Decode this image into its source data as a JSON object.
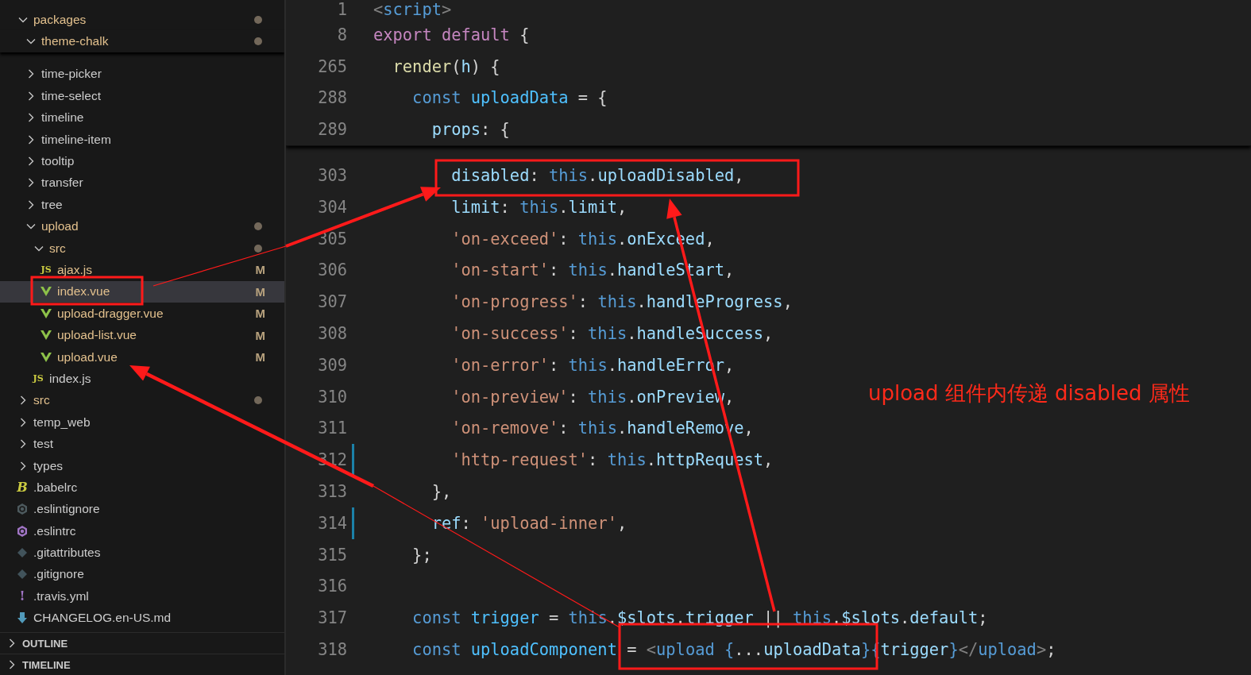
{
  "explorer": {
    "items": [
      {
        "name": "packages",
        "kind": "folder",
        "expanded": true,
        "dot": true,
        "selected": false,
        "children": [
          {
            "name": "theme-chalk",
            "kind": "folder",
            "expanded": true,
            "dot": true,
            "selected": false
          },
          {
            "name": "time-picker",
            "kind": "folder",
            "expanded": false,
            "dot": false,
            "selected": false
          },
          {
            "name": "time-select",
            "kind": "folder",
            "expanded": false,
            "dot": false,
            "selected": false
          },
          {
            "name": "timeline",
            "kind": "folder",
            "expanded": false,
            "dot": false,
            "selected": false
          },
          {
            "name": "timeline-item",
            "kind": "folder",
            "expanded": false,
            "dot": false,
            "selected": false
          },
          {
            "name": "tooltip",
            "kind": "folder",
            "expanded": false,
            "dot": false,
            "selected": false
          },
          {
            "name": "transfer",
            "kind": "folder",
            "expanded": false,
            "dot": false,
            "selected": false
          },
          {
            "name": "tree",
            "kind": "folder",
            "expanded": false,
            "dot": false,
            "selected": false
          },
          {
            "name": "upload",
            "kind": "folder",
            "expanded": true,
            "dot": true,
            "selected": false,
            "children": [
              {
                "name": "src",
                "kind": "folder",
                "expanded": true,
                "dot": true,
                "selected": false,
                "children": [
                  {
                    "name": "ajax.js",
                    "kind": "js",
                    "icon_text": "JS",
                    "status": "M",
                    "selected": false
                  },
                  {
                    "name": "index.vue",
                    "kind": "vue",
                    "status": "M",
                    "selected": true
                  },
                  {
                    "name": "upload-dragger.vue",
                    "kind": "vue",
                    "status": "M",
                    "selected": false
                  },
                  {
                    "name": "upload-list.vue",
                    "kind": "vue",
                    "status": "M",
                    "selected": false
                  },
                  {
                    "name": "upload.vue",
                    "kind": "vue",
                    "status": "M",
                    "selected": false
                  }
                ]
              },
              {
                "name": "index.js",
                "kind": "js",
                "icon_text": "JS",
                "selected": false
              }
            ]
          }
        ]
      },
      {
        "name": "src",
        "kind": "folder",
        "expanded": false,
        "dot": true,
        "selected": false
      },
      {
        "name": "temp_web",
        "kind": "folder",
        "expanded": false,
        "dot": false,
        "selected": false
      },
      {
        "name": "test",
        "kind": "folder",
        "expanded": false,
        "dot": false,
        "selected": false
      },
      {
        "name": "types",
        "kind": "folder",
        "expanded": false,
        "dot": false,
        "selected": false
      },
      {
        "name": ".babelrc",
        "kind": "babel",
        "icon_text": "B",
        "selected": false
      },
      {
        "name": ".eslintignore",
        "kind": "eslint-ignore",
        "selected": false
      },
      {
        "name": ".eslintrc",
        "kind": "eslint",
        "selected": false
      },
      {
        "name": ".gitattributes",
        "kind": "git",
        "selected": false
      },
      {
        "name": ".gitignore",
        "kind": "git",
        "selected": false
      },
      {
        "name": ".travis.yml",
        "kind": "yaml",
        "icon_text": "!",
        "selected": false
      },
      {
        "name": "CHANGELOG.en-US.md",
        "kind": "markdown",
        "selected": false
      }
    ]
  },
  "panels": [
    {
      "title": "OUTLINE",
      "expanded": false
    },
    {
      "title": "TIMELINE",
      "expanded": false
    }
  ],
  "editor": {
    "sticky_lines": [
      {
        "number": "1",
        "tokens": [
          {
            "kind": "tag",
            "text": "<"
          },
          {
            "kind": "tagname",
            "text": "script"
          },
          {
            "kind": "tag",
            "text": ">"
          }
        ]
      },
      {
        "number": "8",
        "tokens": [
          {
            "kind": "kw",
            "text": "export default"
          },
          {
            "kind": "punc",
            "text": " {"
          }
        ]
      },
      {
        "number": "265",
        "tokens": [
          {
            "kind": "fn",
            "text": "  render"
          },
          {
            "kind": "punc",
            "text": "("
          },
          {
            "kind": "param",
            "text": "h"
          },
          {
            "kind": "punc",
            "text": ") {"
          }
        ]
      },
      {
        "number": "288",
        "tokens": [
          {
            "kind": "storage",
            "text": "    const "
          },
          {
            "kind": "var",
            "text": "uploadData"
          },
          {
            "kind": "punc",
            "text": " = {"
          }
        ]
      },
      {
        "number": "289",
        "tokens": [
          {
            "kind": "prop",
            "text": "      props"
          },
          {
            "kind": "punc",
            "text": ": {"
          }
        ]
      }
    ],
    "lines": [
      {
        "number": "303",
        "changed": false,
        "tokens": [
          {
            "kind": "prop",
            "text": "        disabled"
          },
          {
            "kind": "punc",
            "text": ": "
          },
          {
            "kind": "storage",
            "text": "this"
          },
          {
            "kind": "punc",
            "text": "."
          },
          {
            "kind": "prop",
            "text": "uploadDisabled"
          },
          {
            "kind": "punc",
            "text": ","
          }
        ]
      },
      {
        "number": "304",
        "changed": false,
        "tokens": [
          {
            "kind": "prop",
            "text": "        limit"
          },
          {
            "kind": "punc",
            "text": ": "
          },
          {
            "kind": "storage",
            "text": "this"
          },
          {
            "kind": "punc",
            "text": "."
          },
          {
            "kind": "prop",
            "text": "limit"
          },
          {
            "kind": "punc",
            "text": ","
          }
        ]
      },
      {
        "number": "305",
        "changed": false,
        "tokens": [
          {
            "kind": "str",
            "text": "        'on-exceed'"
          },
          {
            "kind": "punc",
            "text": ": "
          },
          {
            "kind": "storage",
            "text": "this"
          },
          {
            "kind": "punc",
            "text": "."
          },
          {
            "kind": "prop",
            "text": "onExceed"
          },
          {
            "kind": "punc",
            "text": ","
          }
        ]
      },
      {
        "number": "306",
        "changed": false,
        "tokens": [
          {
            "kind": "str",
            "text": "        'on-start'"
          },
          {
            "kind": "punc",
            "text": ": "
          },
          {
            "kind": "storage",
            "text": "this"
          },
          {
            "kind": "punc",
            "text": "."
          },
          {
            "kind": "prop",
            "text": "handleStart"
          },
          {
            "kind": "punc",
            "text": ","
          }
        ]
      },
      {
        "number": "307",
        "changed": false,
        "tokens": [
          {
            "kind": "str",
            "text": "        'on-progress'"
          },
          {
            "kind": "punc",
            "text": ": "
          },
          {
            "kind": "storage",
            "text": "this"
          },
          {
            "kind": "punc",
            "text": "."
          },
          {
            "kind": "prop",
            "text": "handleProgress"
          },
          {
            "kind": "punc",
            "text": ","
          }
        ]
      },
      {
        "number": "308",
        "changed": false,
        "tokens": [
          {
            "kind": "str",
            "text": "        'on-success'"
          },
          {
            "kind": "punc",
            "text": ": "
          },
          {
            "kind": "storage",
            "text": "this"
          },
          {
            "kind": "punc",
            "text": "."
          },
          {
            "kind": "prop",
            "text": "handleSuccess"
          },
          {
            "kind": "punc",
            "text": ","
          }
        ]
      },
      {
        "number": "309",
        "changed": false,
        "tokens": [
          {
            "kind": "str",
            "text": "        'on-error'"
          },
          {
            "kind": "punc",
            "text": ": "
          },
          {
            "kind": "storage",
            "text": "this"
          },
          {
            "kind": "punc",
            "text": "."
          },
          {
            "kind": "prop",
            "text": "handleError"
          },
          {
            "kind": "punc",
            "text": ","
          }
        ]
      },
      {
        "number": "310",
        "changed": false,
        "tokens": [
          {
            "kind": "str",
            "text": "        'on-preview'"
          },
          {
            "kind": "punc",
            "text": ": "
          },
          {
            "kind": "storage",
            "text": "this"
          },
          {
            "kind": "punc",
            "text": "."
          },
          {
            "kind": "prop",
            "text": "onPreview"
          },
          {
            "kind": "punc",
            "text": ","
          }
        ]
      },
      {
        "number": "311",
        "changed": false,
        "tokens": [
          {
            "kind": "str",
            "text": "        'on-remove'"
          },
          {
            "kind": "punc",
            "text": ": "
          },
          {
            "kind": "storage",
            "text": "this"
          },
          {
            "kind": "punc",
            "text": "."
          },
          {
            "kind": "prop",
            "text": "handleRemove"
          },
          {
            "kind": "punc",
            "text": ","
          }
        ]
      },
      {
        "number": "312",
        "changed": true,
        "tokens": [
          {
            "kind": "str",
            "text": "        'http-request'"
          },
          {
            "kind": "punc",
            "text": ": "
          },
          {
            "kind": "storage",
            "text": "this"
          },
          {
            "kind": "punc",
            "text": "."
          },
          {
            "kind": "prop",
            "text": "httpRequest"
          },
          {
            "kind": "punc",
            "text": ","
          }
        ]
      },
      {
        "number": "313",
        "changed": false,
        "tokens": [
          {
            "kind": "punc",
            "text": "      },"
          }
        ]
      },
      {
        "number": "314",
        "changed": true,
        "tokens": [
          {
            "kind": "prop",
            "text": "      ref"
          },
          {
            "kind": "punc",
            "text": ": "
          },
          {
            "kind": "str",
            "text": "'upload-inner'"
          },
          {
            "kind": "punc",
            "text": ","
          }
        ]
      },
      {
        "number": "315",
        "changed": false,
        "tokens": [
          {
            "kind": "punc",
            "text": "    };"
          }
        ]
      },
      {
        "number": "316",
        "changed": false
      },
      {
        "number": "317",
        "changed": false,
        "tokens": [
          {
            "kind": "storage",
            "text": "    const "
          },
          {
            "kind": "var",
            "text": "trigger"
          },
          {
            "kind": "punc",
            "text": " = "
          },
          {
            "kind": "storage",
            "text": "this"
          },
          {
            "kind": "punc",
            "text": "."
          },
          {
            "kind": "prop",
            "text": "$slots"
          },
          {
            "kind": "punc",
            "text": "."
          },
          {
            "kind": "prop",
            "text": "trigger"
          },
          {
            "kind": "punc",
            "text": " || "
          },
          {
            "kind": "storage",
            "text": "this"
          },
          {
            "kind": "punc",
            "text": "."
          },
          {
            "kind": "prop",
            "text": "$slots"
          },
          {
            "kind": "punc",
            "text": "."
          },
          {
            "kind": "prop",
            "text": "default"
          },
          {
            "kind": "punc",
            "text": ";"
          }
        ]
      },
      {
        "number": "318",
        "changed": false,
        "tokens": [
          {
            "kind": "storage",
            "text": "    const "
          },
          {
            "kind": "var",
            "text": "uploadComponent"
          },
          {
            "kind": "punc",
            "text": " = "
          },
          {
            "kind": "tag",
            "text": "<"
          },
          {
            "kind": "tagname",
            "text": "upload"
          },
          {
            "kind": "storage",
            "text": " {"
          },
          {
            "kind": "punc",
            "text": "..."
          },
          {
            "kind": "prop",
            "text": "uploadData"
          },
          {
            "kind": "storage",
            "text": "}"
          },
          {
            "kind": "storage",
            "text": "{"
          },
          {
            "kind": "prop",
            "text": "trigger"
          },
          {
            "kind": "storage",
            "text": "}"
          },
          {
            "kind": "tag",
            "text": "</"
          },
          {
            "kind": "tagname",
            "text": "upload"
          },
          {
            "kind": "tag",
            "text": ">"
          },
          {
            "kind": "punc",
            "text": ";"
          }
        ]
      }
    ]
  },
  "annotation": {
    "note": "upload 组件内传递 disabled 属性"
  }
}
